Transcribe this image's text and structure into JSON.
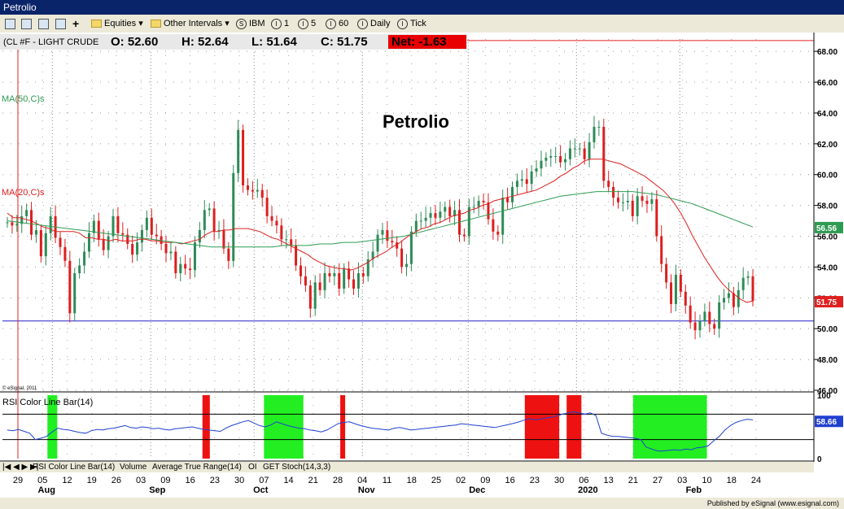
{
  "window": {
    "title": "Petrolio"
  },
  "toolbar": {
    "equities": "Equities",
    "other_intervals": "Other Intervals",
    "s_btn": "IBM",
    "i1": "1",
    "i5": "5",
    "i60": "60",
    "daily": "Daily",
    "tick": "Tick"
  },
  "header": {
    "symbol": "(CL #F - LIGHT CRUDE",
    "open": "O: 52.60",
    "high": "H: 52.64",
    "low": "L: 51.64",
    "close": "C: 51.75",
    "net": "Net: -1.63"
  },
  "tabs": [
    "RSI Color Line Bar(14)",
    "Volume",
    "Average True Range(14)",
    "OI",
    "GET Stoch(14,3,3)"
  ],
  "footer": "Published by eSignal (www.esignal.com)",
  "colors": {
    "up": "#2e8b57",
    "down": "#dc1e1e",
    "ma50": "#2e9b52",
    "ma20": "#dd2020",
    "rsi": "#2040d0",
    "green_zone": "#22ee22",
    "red_zone": "#ee1111"
  },
  "chart_data": [
    {
      "type": "candlestick",
      "title": "Petrolio",
      "series_labels": [
        "MA(50,C)s",
        "MA(20,C)s"
      ],
      "watermark": "© eSignal, 2011",
      "ylim": [
        46,
        68.8
      ],
      "y_ticks": [
        "46.00",
        "48.00",
        "50.00",
        "52.00",
        "54.00",
        "56.00",
        "58.00",
        "60.00",
        "62.00",
        "64.00",
        "66.00",
        "68.00"
      ],
      "horizontal_lines": [
        68.7,
        50.5
      ],
      "last_ma50": "56.56",
      "last_close": "51.75",
      "x_ticks": [
        "29",
        "05",
        "12",
        "19",
        "26",
        "03",
        "09",
        "16",
        "23",
        "30",
        "07",
        "14",
        "21",
        "28",
        "04",
        "11",
        "18",
        "25",
        "02",
        "09",
        "16",
        "23",
        "30",
        "06",
        "13",
        "21",
        "27",
        "03",
        "10",
        "18",
        "24"
      ],
      "month_labels": [
        "Aug",
        "Sep",
        "Oct",
        "Nov",
        "Dec",
        "2020",
        "Feb"
      ],
      "closes": [
        56.9,
        56.7,
        56.8,
        57.3,
        57.7,
        56.1,
        56.4,
        54.7,
        56.2,
        57.3,
        55.9,
        55.3,
        54.4,
        51.0,
        53.6,
        54.1,
        55.0,
        56.2,
        57.0,
        55.8,
        55.1,
        56.0,
        57.3,
        56.2,
        56.1,
        55.5,
        54.8,
        55.6,
        56.4,
        57.2,
        56.1,
        56.0,
        55.5,
        54.9,
        55.0,
        53.6,
        54.2,
        53.9,
        53.8,
        55.6,
        56.4,
        57.7,
        57.8,
        56.3,
        56.4,
        55.2,
        54.4,
        60.1,
        62.9,
        59.3,
        59.0,
        58.9,
        59.0,
        58.5,
        57.3,
        57.0,
        56.7,
        55.8,
        55.8,
        55.4,
        54.1,
        53.4,
        52.8,
        51.3,
        53.0,
        52.5,
        53.6,
        53.4,
        53.6,
        52.6,
        53.9,
        53.2,
        52.6,
        53.6,
        53.4,
        54.5,
        55.0,
        56.1,
        56.4,
        55.7,
        55.6,
        55.2,
        54.0,
        54.2,
        56.3,
        57.0,
        57.0,
        57.2,
        57.5,
        57.2,
        57.6,
        57.9,
        57.3,
        57.7,
        56.1,
        56.0,
        57.9,
        57.9,
        58.3,
        58.2,
        57.1,
        56.3,
        56.1,
        58.5,
        58.2,
        59.2,
        59.6,
        59.7,
        59.4,
        60.2,
        60.4,
        60.9,
        61.1,
        61.2,
        61.2,
        60.8,
        61.0,
        61.7,
        61.7,
        61.7,
        61.0,
        62.1,
        63.1,
        63.1,
        59.6,
        59.2,
        58.5,
        58.2,
        58.2,
        58.3,
        57.3,
        58.6,
        58.3,
        58.1,
        58.4,
        56.0,
        54.2,
        53.0,
        51.6,
        53.5,
        52.4,
        51.5,
        50.4,
        49.9,
        50.5,
        51.1,
        50.3,
        50.0,
        51.7,
        52.0,
        52.3,
        51.4,
        52.5,
        53.3,
        53.4,
        51.8
      ],
      "ma20": [
        57.5,
        57.2,
        57.2,
        57.1,
        57.0,
        56.8,
        56.6,
        56.5,
        56.3,
        56.3,
        56.3,
        56.3,
        56.2,
        55.9,
        55.9,
        55.8,
        55.8,
        55.7,
        55.8,
        55.7,
        55.7,
        55.7,
        55.8,
        55.8,
        55.7,
        55.7,
        55.6,
        55.6,
        55.6,
        55.5,
        55.6,
        55.7,
        55.8,
        56.1,
        56.3,
        56.3,
        56.4,
        56.4,
        56.5,
        56.5,
        56.5,
        56.4,
        56.3,
        56.1,
        55.9,
        55.8,
        55.6,
        55.4,
        55.2,
        55.0,
        54.8,
        54.5,
        54.3,
        54.1,
        54.0,
        53.9,
        53.9,
        53.8,
        53.9,
        54.1,
        54.3,
        54.6,
        54.8,
        55.0,
        55.3,
        55.5,
        55.8,
        56.1,
        56.3,
        56.5,
        56.6,
        56.8,
        56.9,
        57.1,
        57.3,
        57.4,
        57.5,
        57.7,
        57.8,
        58.0,
        58.1,
        58.3,
        58.4,
        58.5,
        58.6,
        58.7,
        58.8,
        58.9,
        59.0,
        59.2,
        59.4,
        59.6,
        59.9,
        60.1,
        60.4,
        60.6,
        60.9,
        61.0,
        61.0,
        61.0,
        60.9,
        60.8,
        60.7,
        60.5,
        60.3,
        60.1,
        59.9,
        59.6,
        59.3,
        59.0,
        58.6,
        58.1,
        57.5,
        56.8,
        56.0,
        55.3,
        54.6,
        54.0,
        53.4,
        52.9,
        52.5,
        52.2,
        51.9,
        51.7,
        51.8
      ],
      "ma50": [
        57.0,
        56.9,
        56.8,
        56.7,
        56.6,
        56.5,
        56.4,
        56.3,
        56.2,
        56.1,
        56.0,
        55.9,
        55.8,
        55.7,
        55.6,
        55.5,
        55.4,
        55.3,
        55.3,
        55.3,
        55.3,
        55.3,
        55.3,
        55.4,
        55.4,
        55.4,
        55.5,
        55.5,
        55.6,
        55.6,
        55.7,
        55.8,
        55.9,
        56.0,
        56.2,
        56.4,
        56.6,
        56.8,
        57.0,
        57.2,
        57.4,
        57.6,
        57.8,
        58.0,
        58.2,
        58.4,
        58.6,
        58.7,
        58.8,
        58.9,
        58.9,
        58.9,
        58.9,
        58.8,
        58.7,
        58.5,
        58.3,
        58.1,
        57.8,
        57.5,
        57.2,
        56.9,
        56.6
      ],
      "rsi_ylim": [
        0,
        100
      ],
      "rsi_label": "RSI Color Line Bar(14)",
      "rsi_ticks": [
        "0",
        "100"
      ],
      "rsi_last": "58.66",
      "rsi_levels": [
        70,
        30
      ],
      "rsi": [
        45,
        44,
        46,
        43,
        40,
        30,
        32,
        35,
        42,
        48,
        46,
        45,
        43,
        41,
        40,
        44,
        46,
        45,
        47,
        48,
        50,
        52,
        49,
        48,
        50,
        49,
        47,
        48,
        46,
        45,
        47,
        48,
        49,
        50,
        48,
        46,
        45,
        44,
        43,
        48,
        52,
        55,
        58,
        60,
        56,
        52,
        50,
        53,
        58,
        55,
        52,
        50,
        48,
        47,
        45,
        44,
        42,
        45,
        50,
        55,
        57,
        58,
        55,
        52,
        50,
        48,
        47,
        46,
        45,
        48,
        49,
        47,
        45,
        46,
        47,
        48,
        49,
        50,
        51,
        52,
        53,
        55,
        54,
        53,
        52,
        51,
        50,
        49,
        51,
        53,
        55,
        57,
        60,
        63,
        61,
        62,
        64,
        65,
        67,
        70,
        72,
        74,
        72,
        70,
        72,
        68,
        40,
        37,
        35,
        35,
        34,
        33,
        32,
        30,
        18,
        15,
        12,
        12,
        13,
        14,
        13,
        15,
        14,
        17,
        18,
        20,
        28,
        35,
        45,
        52,
        57,
        60,
        62,
        61
      ],
      "rsi_thick": [
        null,
        null,
        null,
        null,
        null,
        null,
        null,
        null,
        null,
        null,
        null,
        null,
        null,
        null,
        null,
        null,
        null,
        null,
        null,
        null,
        null,
        null,
        null,
        null,
        null,
        null,
        null,
        null,
        null,
        null,
        null,
        null,
        null,
        null,
        null,
        null,
        null,
        null,
        null,
        null,
        null,
        null,
        null,
        null,
        null,
        null,
        null,
        null,
        null,
        null,
        null,
        null,
        null,
        null,
        null,
        null,
        null,
        null,
        null,
        null,
        null,
        null,
        null,
        null,
        null,
        null,
        null,
        null,
        null,
        null,
        null,
        null,
        null,
        null,
        null,
        null,
        null,
        null,
        null,
        null,
        null,
        null,
        null,
        null,
        null,
        null,
        null,
        null,
        null,
        null,
        null,
        null,
        null,
        null,
        null,
        null,
        null,
        null,
        null,
        null,
        null,
        null,
        null,
        null,
        null,
        null,
        null,
        null,
        null,
        null,
        null,
        null,
        null,
        null,
        null,
        null,
        null,
        null,
        null,
        null,
        null,
        null,
        null,
        null,
        null,
        null,
        null,
        null,
        null,
        null,
        null,
        null,
        null,
        null
      ],
      "rsi_zones": [
        {
          "color": "green",
          "from": "29 Jul",
          "to": "31 Jul"
        },
        {
          "color": "red",
          "from": "13 Sep",
          "to": "16 Sep"
        },
        {
          "color": "green",
          "from": "04 Oct",
          "to": "15 Oct"
        },
        {
          "color": "red",
          "from": "24 Oct",
          "to": "25 Oct"
        },
        {
          "color": "red",
          "from": "18 Dec",
          "to": "31 Dec"
        },
        {
          "color": "red",
          "from": "02 Jan",
          "to": "07 Jan"
        },
        {
          "color": "green",
          "from": "24 Jan",
          "to": "11 Feb"
        }
      ]
    }
  ]
}
